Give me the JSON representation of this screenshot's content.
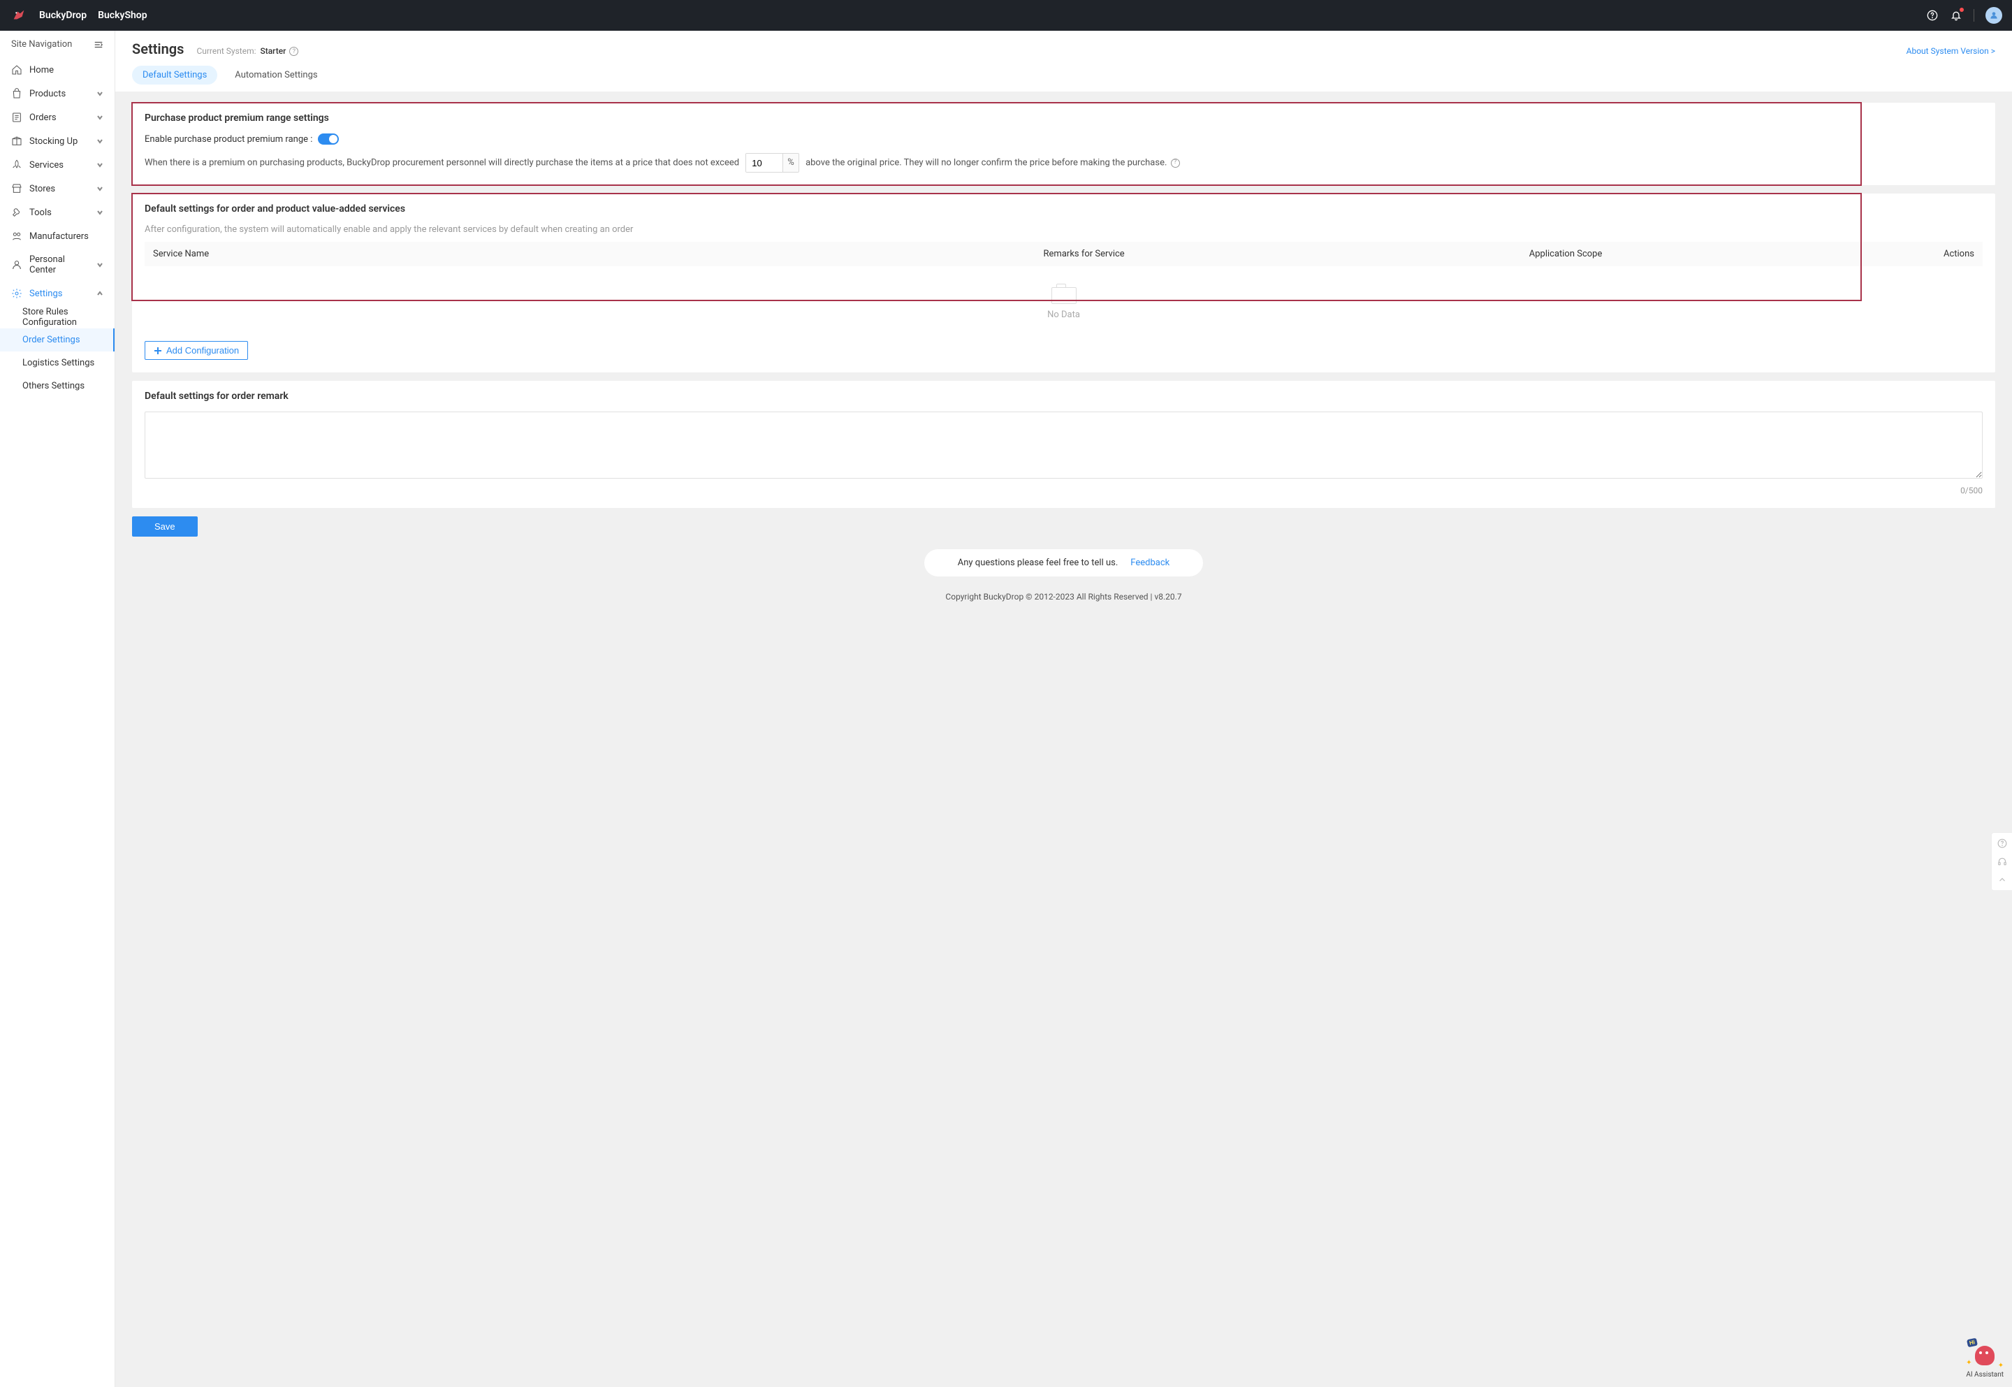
{
  "topbar": {
    "brand1": "BuckyDrop",
    "brand2": "BuckyShop"
  },
  "sidebar": {
    "header": "Site Navigation",
    "items": [
      {
        "label": "Home"
      },
      {
        "label": "Products"
      },
      {
        "label": "Orders"
      },
      {
        "label": "Stocking Up"
      },
      {
        "label": "Services"
      },
      {
        "label": "Stores"
      },
      {
        "label": "Tools"
      },
      {
        "label": "Manufacturers"
      },
      {
        "label": "Personal Center"
      },
      {
        "label": "Settings"
      }
    ],
    "settings_sub": [
      {
        "label": "Store Rules Configuration"
      },
      {
        "label": "Order Settings"
      },
      {
        "label": "Logistics Settings"
      },
      {
        "label": "Others Settings"
      }
    ]
  },
  "page": {
    "title": "Settings",
    "current_system_label": "Current System:",
    "current_system_value": "Starter",
    "about_link": "About System Version >",
    "tabs": {
      "default": "Default Settings",
      "automation": "Automation Settings"
    }
  },
  "premium": {
    "title": "Purchase product premium range settings",
    "enable_label": "Enable purchase product premium range :",
    "line_prefix": "When there is a premium on purchasing products, BuckyDrop procurement personnel will directly purchase the items at a price that does not exceed",
    "value": "10",
    "suffix_sym": "%",
    "line_suffix": "above the original price. They will no longer confirm the price before making the purchase."
  },
  "vas": {
    "title": "Default settings for order and product value-added services",
    "desc": "After configuration, the system will automatically enable and apply the relevant services by default when creating an order",
    "cols": {
      "c1": "Service Name",
      "c2": "Remarks for Service",
      "c3": "Application Scope",
      "c4": "Actions"
    },
    "empty": "No Data",
    "add_btn": "Add Configuration"
  },
  "remark": {
    "title": "Default settings for order remark",
    "counter": "0/500"
  },
  "save_label": "Save",
  "footer": {
    "question": "Any questions please feel free to tell us.",
    "feedback": "Feedback",
    "copyright": "Copyright BuckyDrop © 2012-2023 All Rights Reserved | v8.20.7"
  },
  "assistant_label": "AI Assistant"
}
